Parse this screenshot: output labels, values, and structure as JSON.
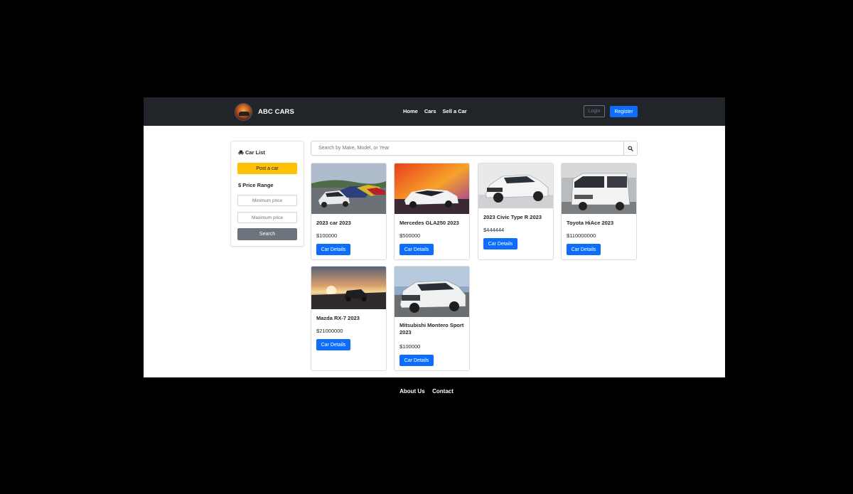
{
  "brand": {
    "name": "ABC CARS"
  },
  "nav": {
    "links": [
      "Home",
      "Cars",
      "Sell a Car"
    ],
    "login": "Login",
    "register": "Register"
  },
  "sidebar": {
    "heading": "Car List",
    "heading_icon": "car-icon",
    "post_button": "Post a car",
    "price_heading": "$ Price Range",
    "min_placeholder": "Minimum price",
    "max_placeholder": "Maximum price",
    "search_button": "Search"
  },
  "search": {
    "placeholder": "Search by Make, Model, or Year",
    "icon": "search-icon"
  },
  "cars": [
    {
      "title": "2023 car 2023",
      "price": "$100000",
      "button": "Car Details"
    },
    {
      "title": "Mercedes GLA250 2023",
      "price": "$500000",
      "button": "Car Details"
    },
    {
      "title": "2023 Civic Type R 2023",
      "price": "$444444",
      "button": "Car Details"
    },
    {
      "title": "Toyota HiAce 2023",
      "price": "$110000000",
      "button": "Car Details"
    },
    {
      "title": "Mazda RX-7 2023",
      "price": "$21000000",
      "button": "Car Details"
    },
    {
      "title": "Mitsubishi Montero Sport 2023",
      "price": "$100000",
      "button": "Car Details"
    }
  ],
  "footer": {
    "links": [
      "About Us",
      "Contact"
    ]
  },
  "colors": {
    "navbar": "#212529",
    "primary": "#0d6efd",
    "warning": "#ffc107",
    "secondary": "#6c757d"
  }
}
